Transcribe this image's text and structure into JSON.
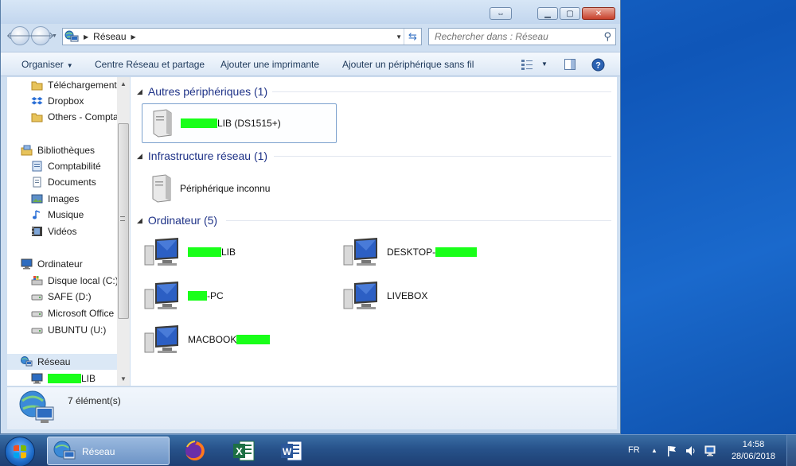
{
  "window": {
    "location": "Réseau",
    "search_placeholder": "Rechercher dans : Réseau"
  },
  "toolbar": {
    "organize": "Organiser",
    "network_center": "Centre Réseau et partage",
    "add_printer": "Ajouter une imprimante",
    "add_wireless": "Ajouter un périphérique sans fil"
  },
  "navpane": {
    "downloads": "Téléchargements",
    "dropbox": "Dropbox",
    "others": "Others - Compta",
    "libraries": "Bibliothèques",
    "comptabilite": "Comptabilité",
    "documents": "Documents",
    "images": "Images",
    "music": "Musique",
    "videos": "Vidéos",
    "computer": "Ordinateur",
    "local_disk": "Disque local (C:)",
    "safe": "SAFE (D:)",
    "office": "Microsoft Office",
    "ubuntu": "UBUNTU (U:)",
    "network": "Réseau",
    "lib_suffix": "LIB"
  },
  "groups": {
    "other_devices": "Autres périphériques (1)",
    "infrastructure": "Infrastructure réseau (1)",
    "computers": "Ordinateur (5)"
  },
  "devices": {
    "nas_suffix": "LIB (DS1515+)",
    "unknown": "Périphérique inconnu",
    "lib_suffix": "LIB",
    "desktop_prefix": "DESKTOP-",
    "pc_suffix": "-PC",
    "livebox": "LIVEBOX",
    "macbook_prefix": "MACBOOK"
  },
  "details": {
    "count": "7 élément(s)"
  },
  "taskbar": {
    "explorer_label": "Réseau",
    "language": "FR",
    "time": "14:58",
    "date": "28/06/2018"
  },
  "colors": {
    "redaction": "#19ff19",
    "group_header": "#1e3287"
  }
}
